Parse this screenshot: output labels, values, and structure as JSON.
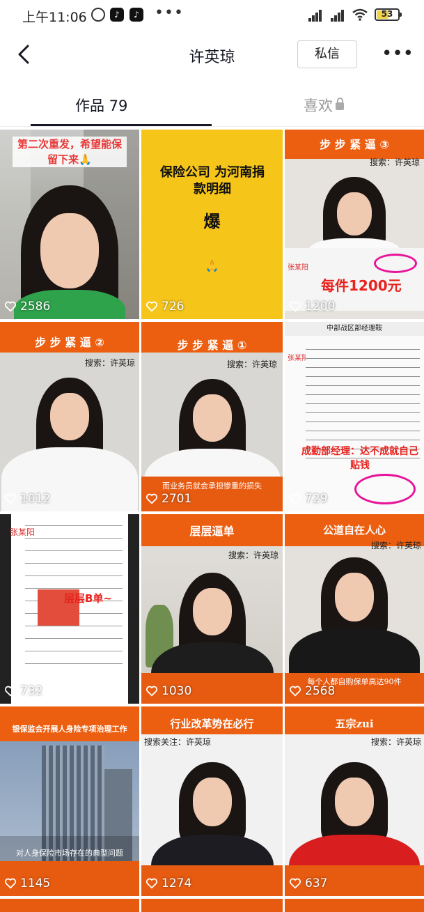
{
  "status_bar": {
    "time": "上午11:06",
    "tiktok_icon": "♪",
    "battery": "53"
  },
  "header": {
    "title": "许英琼",
    "message_button": "私信",
    "more": "•••"
  },
  "tabs": {
    "works": "作品 79",
    "likes": "喜欢"
  },
  "videos": [
    {
      "banner": "第二次重发，希望能保留下来🙏",
      "likes": "2586"
    },
    {
      "banner": "保险公司 为河南捐款明细",
      "logo": "爆",
      "likes": "726"
    },
    {
      "banner": "步 步 紧 逼 ③",
      "search": "搜索：许英琼",
      "overlay": "每件1200元",
      "note": "张某阳",
      "likes": "1200"
    },
    {
      "banner": "步 步 紧 逼 ②",
      "search": "搜索：许英琼",
      "likes": "1012"
    },
    {
      "banner": "步 步 紧 逼 ①",
      "search": "搜索：许英琼",
      "caption": "而业务员就会承担惨重的损失",
      "likes": "2701"
    },
    {
      "banner": "中部战区部经理鞍",
      "overlay": "成勤部经理：达不成就自己贴钱",
      "note": "张某阳",
      "likes": "729"
    },
    {
      "banner": "",
      "overlay": "层层B单~",
      "note": "张某阳",
      "likes": "732"
    },
    {
      "banner": "层层逼单",
      "search": "搜索：许英琼",
      "likes": "1030"
    },
    {
      "banner": "公道自在人心",
      "search": "搜索：许英琼",
      "caption": "每个人都自购保单高达90件",
      "likes": "2568"
    },
    {
      "banner": "银保监会开展人身险专项治理工作",
      "caption": "对人身保险市场存在的典型问题",
      "likes": "1145"
    },
    {
      "banner": "行业改革势在必行",
      "search": "搜索关注：许英琼",
      "likes": "1274"
    },
    {
      "banner": "五宗zui",
      "search": "搜索：许英琼",
      "likes": "637"
    }
  ]
}
